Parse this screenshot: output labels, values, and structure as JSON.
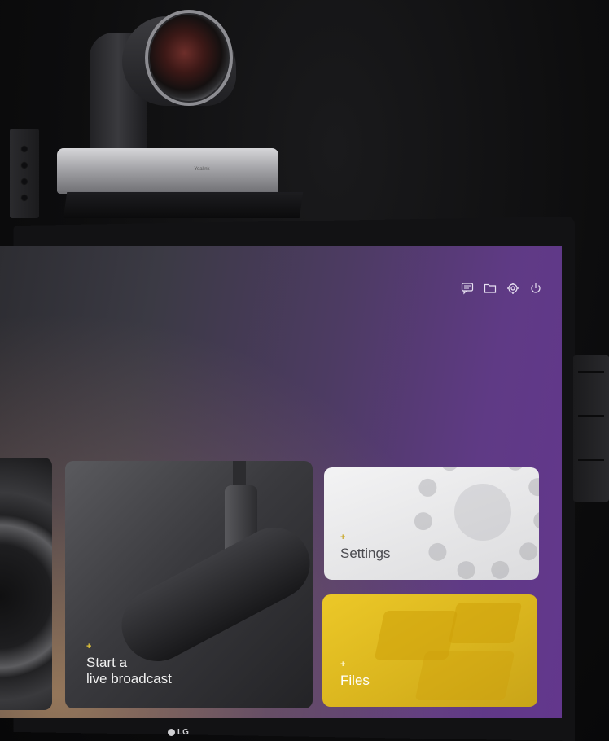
{
  "camera": {
    "brand": "Yealink"
  },
  "toolbar": {
    "icons": [
      "chat-icon",
      "folder-icon",
      "settings-icon",
      "power-icon"
    ]
  },
  "tiles": {
    "broadcast": {
      "plus": "+",
      "label_line1": "Start a",
      "label_line2": "live broadcast"
    },
    "settings": {
      "plus": "+",
      "label": "Settings"
    },
    "files": {
      "plus": "+",
      "label": "Files"
    }
  },
  "monitor": {
    "brand": "LG"
  },
  "colors": {
    "purple": "#63378d",
    "files_yellow": "#ecc828",
    "accent_plus": "#e0c33a"
  }
}
